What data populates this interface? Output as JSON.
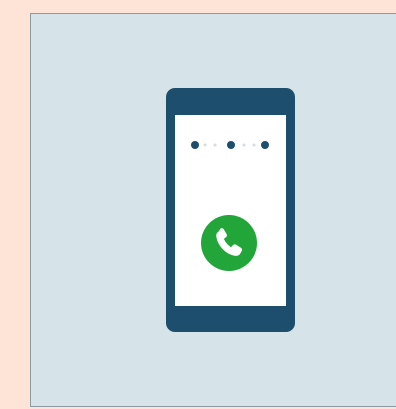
{
  "scene": {
    "icon_name": "phone-call-icon",
    "colors": {
      "page_background": "#fde4d6",
      "panel_background": "#d6e4ea",
      "phone_body": "#1d4e6d",
      "phone_screen": "#ffffff",
      "dot_primary": "#1d4e6d",
      "dot_secondary": "#d6dbe2",
      "call_button": "#22a63a",
      "call_handset": "#ffffff"
    }
  }
}
